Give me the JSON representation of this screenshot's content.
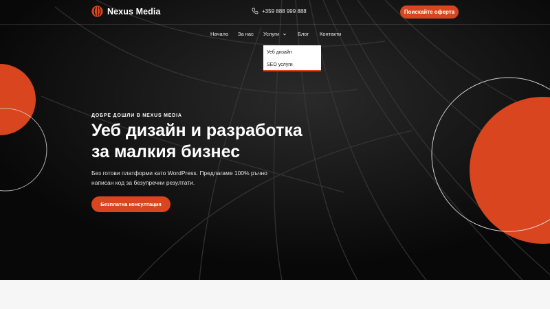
{
  "header": {
    "brand": "Nexus Media",
    "phone": "+359 888 999 888",
    "cta_label": "Поискайте оферта"
  },
  "nav": {
    "items": [
      {
        "label": "Начало"
      },
      {
        "label": "За нас"
      },
      {
        "label": "Услуги"
      },
      {
        "label": "Блог"
      },
      {
        "label": "Контакти"
      }
    ],
    "dropdown": {
      "items": [
        {
          "label": "Уеб дизайн"
        },
        {
          "label": "SEO услуги"
        }
      ]
    }
  },
  "hero": {
    "eyebrow": "ДОБРЕ ДОШЛИ В NEXUS MEDIA",
    "headline_line1": "Уеб дизайн и разработка",
    "headline_line2": "за малкия бизнес",
    "subtext_line1": "Без готови платформи като WordPress. Предлагаме 100% ръчно",
    "subtext_line2": "написан код за безупречни резултати.",
    "cta_label": "Безплатна консултация"
  },
  "icons": {
    "logo": "logo-mark-icon",
    "phone": "phone-icon",
    "services_caret": "chevron-down-icon"
  },
  "colors": {
    "accent": "#d8451e",
    "hero_background": "#0b0b0b",
    "below_background": "#f6f6f6"
  }
}
